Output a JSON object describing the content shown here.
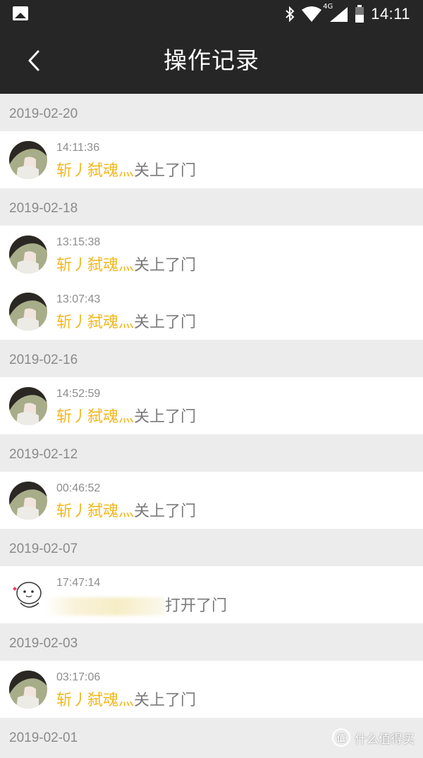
{
  "status_bar": {
    "time": "14:11",
    "network": "4G",
    "icons": [
      "gallery-icon",
      "bluetooth-icon",
      "wifi-icon",
      "signal-icon",
      "battery-icon"
    ]
  },
  "header": {
    "title": "操作记录",
    "back_icon": "chevron-left-icon"
  },
  "colors": {
    "bar": "#262626",
    "user_name": "#f2b81f",
    "action_text": "#7a7a7a",
    "date_header_bg": "#ececec"
  },
  "groups": [
    {
      "date": "2019-02-20",
      "records": [
        {
          "time": "14:11:36",
          "user": "斩丿弑魂灬",
          "action": "关上了门"
        }
      ]
    },
    {
      "date": "2019-02-18",
      "records": [
        {
          "time": "13:15:38",
          "user": "斩丿弑魂灬",
          "action": "关上了门"
        },
        {
          "time": "13:07:43",
          "user": "斩丿弑魂灬",
          "action": "关上了门"
        }
      ]
    },
    {
      "date": "2019-02-16",
      "records": [
        {
          "time": "14:52:59",
          "user": "斩丿弑魂灬",
          "action": "关上了门"
        }
      ]
    },
    {
      "date": "2019-02-12",
      "records": [
        {
          "time": "00:46:52",
          "user": "斩丿弑魂灬",
          "action": "关上了门"
        }
      ]
    },
    {
      "date": "2019-02-07",
      "records": [
        {
          "time": "17:47:14",
          "user": "",
          "action": "打开了门",
          "avatar": "cartoon-bun",
          "name_blurred": true
        }
      ]
    },
    {
      "date": "2019-02-03",
      "records": [
        {
          "time": "03:17:06",
          "user": "斩丿弑魂灬",
          "action": "关上了门"
        }
      ]
    },
    {
      "date": "2019-02-01",
      "records": []
    }
  ],
  "watermark": {
    "badge": "值",
    "text": "什么值得买"
  }
}
